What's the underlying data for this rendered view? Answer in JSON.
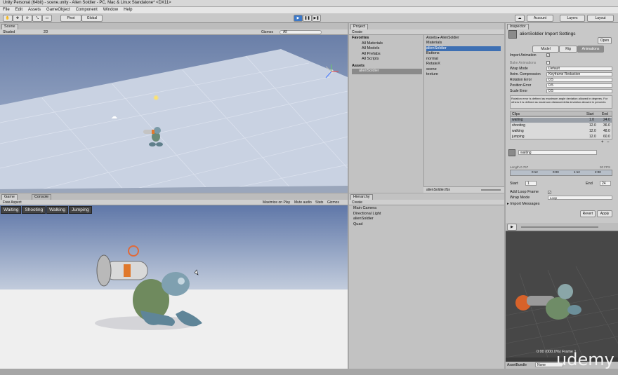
{
  "window_title": "Unity Personal (64bit) - scene.unity - Alien Soldier - PC, Mac & Linux Standalone* <DX11>",
  "menu": [
    "File",
    "Edit",
    "Assets",
    "GameObject",
    "Component",
    "Window",
    "Help"
  ],
  "toolbar": {
    "pivot": "Pivot",
    "global": "Global",
    "account": "Account",
    "layers": "Layers",
    "layout": "Layout"
  },
  "scene": {
    "tab": "Scene",
    "shaded": "Shaded",
    "mode2d": "2D",
    "gizmos": "Gizmos",
    "search": "All"
  },
  "game": {
    "tabs": [
      "Game",
      "Console"
    ],
    "aspect": "Free Aspect",
    "options": [
      "Maximize on Play",
      "Mute audio",
      "Stats",
      "Gizmos"
    ],
    "buttons": [
      "Waiting",
      "Shooting",
      "Walking",
      "Jumping"
    ]
  },
  "project": {
    "tab": "Project",
    "create": "Create",
    "favorites": "Favorites",
    "fav_items": [
      "All Materials",
      "All Models",
      "All Prefabs",
      "All Scripts"
    ],
    "assets": "Assets",
    "asset_items": [
      "alienSoldier"
    ],
    "breadcrumb": "Assets ▸ AlienSoldier",
    "files": [
      "Materials",
      "alienSoldier",
      "Buttons",
      "normal",
      "RotateX",
      "scene",
      "texture"
    ],
    "selected_file": "alienSoldier.fbx"
  },
  "hierarchy": {
    "tab": "Hierarchy",
    "create": "Create",
    "items": [
      "Main Camera",
      "Directional Light",
      "alienSoldier",
      "Quad"
    ]
  },
  "inspector": {
    "tab": "Inspector",
    "title": "alienSoldier Import Settings",
    "open": "Open",
    "tabs": [
      "Model",
      "Rig",
      "Animations"
    ],
    "rows": [
      {
        "label": "Import Animation",
        "value": "✓"
      },
      {
        "label": "Bake Animations",
        "value": ""
      },
      {
        "label": "Wrap Mode",
        "value": "Default"
      },
      {
        "label": "Anim. Compression",
        "value": "Keyframe Reduction"
      },
      {
        "label": "Rotation Error",
        "value": "0.5"
      },
      {
        "label": "Position Error",
        "value": "0.5"
      },
      {
        "label": "Scale Error",
        "value": "0.5"
      }
    ],
    "help": "Rotation error is defined as maximum angle deviation allowed in degrees. For others it is defined as maximum distance/delta deviation allowed in percents",
    "clips_header": [
      "Clips",
      "Start",
      "End"
    ],
    "clips": [
      [
        "waiting",
        "1.0",
        "24.0"
      ],
      [
        "shooting",
        "12.0",
        "36.0"
      ],
      [
        "walking",
        "12.0",
        "48.0"
      ],
      [
        "jumping",
        "12.0",
        "60.0"
      ]
    ],
    "clip_name": "waiting",
    "length": "Length   0.767",
    "fps": "30 FPS",
    "timeline": [
      "0:12",
      "0:00",
      "1:12",
      "2:00"
    ],
    "start_label": "Start",
    "start_value": "1",
    "end_label": "End",
    "end_value": "24",
    "loop_frame": "Add Loop Frame",
    "wrap_mode": "Wrap Mode",
    "wrap_value": "Loop",
    "import_messages": "Import Messages",
    "revert": "Revert",
    "apply": "Apply",
    "preview_status": "0:00 (000.0%) Frame 1",
    "asset_bundle": "AssetBundle",
    "asset_bundle_value": "None"
  },
  "watermark": "udemy",
  "colors": {
    "accent": "#3c78c8",
    "selection": "#3d6fb3"
  }
}
